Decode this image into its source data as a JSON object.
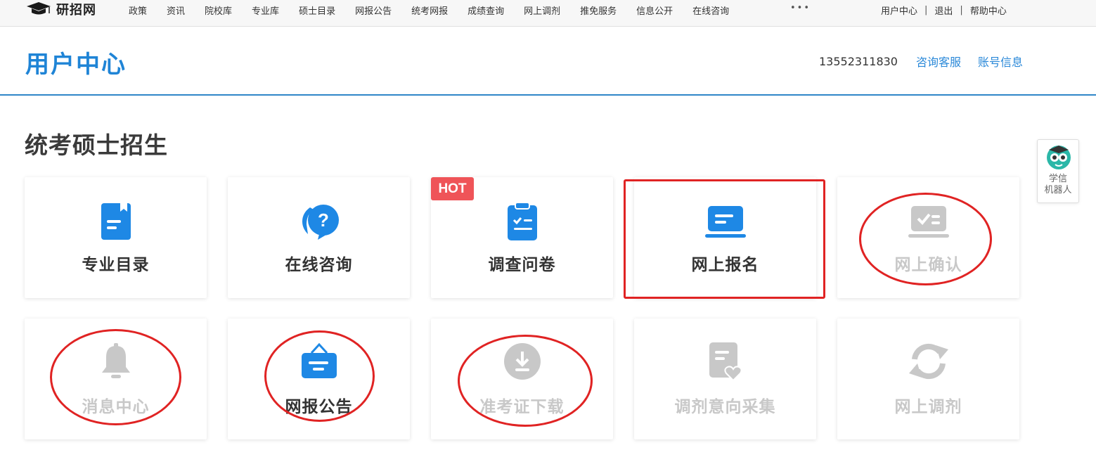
{
  "topnav": {
    "logo_text": "研招网",
    "links": [
      "政策",
      "资讯",
      "院校库",
      "专业库",
      "硕士目录",
      "网报公告",
      "统考网报",
      "成绩查询",
      "网上调剂",
      "推免服务",
      "信息公开",
      "在线咨询"
    ],
    "more": "•••",
    "user_center": "用户中心",
    "logout": "退出",
    "help": "帮助中心",
    "separator": "|"
  },
  "header": {
    "title": "用户中心",
    "phone": "13552311830",
    "consult": "咨询客服",
    "account": "账号信息"
  },
  "section": {
    "title": "统考硕士招生"
  },
  "cards": {
    "major_catalog": "专业目录",
    "online_consult": "在线咨询",
    "survey": "调查问卷",
    "online_register": "网上报名",
    "online_confirm": "网上确认",
    "messages": "消息中心",
    "announcements": "网报公告",
    "admission_ticket": "准考证下载",
    "adjust_intent": "调剂意向采集",
    "online_adjust": "网上调剂"
  },
  "badge": {
    "hot": "HOT"
  },
  "robot": {
    "line1": "学信",
    "line2": "机器人"
  },
  "colors": {
    "primary": "#1f84d6",
    "icon_blue": "#1e88e5",
    "disabled": "#c8c8c8",
    "hot": "#ef5458",
    "annotation_red": "#e02323"
  }
}
